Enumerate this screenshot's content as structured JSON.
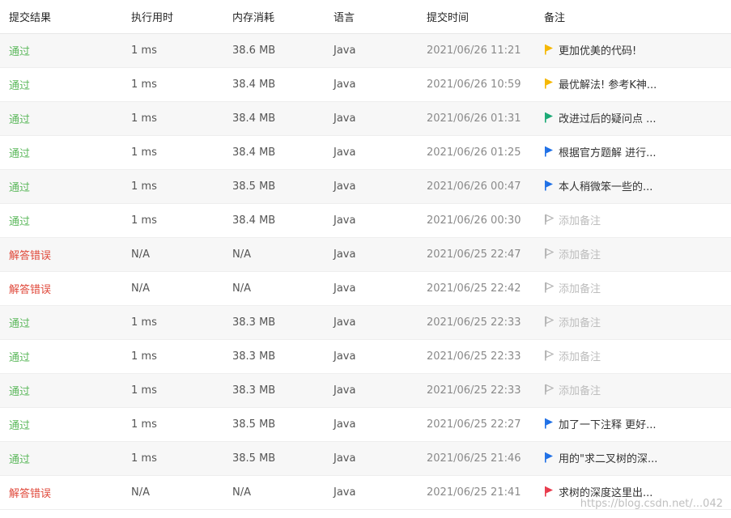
{
  "headers": {
    "status": "提交结果",
    "runtime": "执行用时",
    "memory": "内存消耗",
    "language": "语言",
    "submit_time": "提交时间",
    "note": "备注"
  },
  "colors": {
    "accepted": "#5cb85c",
    "wrong": "#e0493b",
    "flag_yellow": "#f5b700",
    "flag_green": "#19a974",
    "flag_blue": "#1e6fe6",
    "flag_red": "#e8394b",
    "flag_empty": "#b5b5b5"
  },
  "rows": [
    {
      "status": "通过",
      "type": "accepted",
      "runtime": "1 ms",
      "memory": "38.6 MB",
      "language": "Java",
      "time": "2021/06/26 11:21",
      "note": "更加优美的代码!",
      "flag": "yellow",
      "flag_icon": "flag-icon"
    },
    {
      "status": "通过",
      "type": "accepted",
      "runtime": "1 ms",
      "memory": "38.4 MB",
      "language": "Java",
      "time": "2021/06/26 10:59",
      "note": "最优解法! 参考K神...",
      "flag": "yellow",
      "flag_icon": "flag-icon"
    },
    {
      "status": "通过",
      "type": "accepted",
      "runtime": "1 ms",
      "memory": "38.4 MB",
      "language": "Java",
      "time": "2021/06/26 01:31",
      "note": "改进过后的疑问点 ...",
      "flag": "green",
      "flag_icon": "flag-icon"
    },
    {
      "status": "通过",
      "type": "accepted",
      "runtime": "1 ms",
      "memory": "38.4 MB",
      "language": "Java",
      "time": "2021/06/26 01:25",
      "note": "根据官方题解 进行...",
      "flag": "blue",
      "flag_icon": "flag-icon"
    },
    {
      "status": "通过",
      "type": "accepted",
      "runtime": "1 ms",
      "memory": "38.5 MB",
      "language": "Java",
      "time": "2021/06/26 00:47",
      "note": "本人稍微笨一些的...",
      "flag": "blue",
      "flag_icon": "flag-icon"
    },
    {
      "status": "通过",
      "type": "accepted",
      "runtime": "1 ms",
      "memory": "38.4 MB",
      "language": "Java",
      "time": "2021/06/26 00:30",
      "note": "添加备注",
      "flag": "empty",
      "flag_icon": "flag-outline-icon"
    },
    {
      "status": "解答错误",
      "type": "wrong",
      "runtime": "N/A",
      "memory": "N/A",
      "language": "Java",
      "time": "2021/06/25 22:47",
      "note": "添加备注",
      "flag": "empty",
      "flag_icon": "flag-outline-icon"
    },
    {
      "status": "解答错误",
      "type": "wrong",
      "runtime": "N/A",
      "memory": "N/A",
      "language": "Java",
      "time": "2021/06/25 22:42",
      "note": "添加备注",
      "flag": "empty",
      "flag_icon": "flag-outline-icon"
    },
    {
      "status": "通过",
      "type": "accepted",
      "runtime": "1 ms",
      "memory": "38.3 MB",
      "language": "Java",
      "time": "2021/06/25 22:33",
      "note": "添加备注",
      "flag": "empty",
      "flag_icon": "flag-outline-icon"
    },
    {
      "status": "通过",
      "type": "accepted",
      "runtime": "1 ms",
      "memory": "38.3 MB",
      "language": "Java",
      "time": "2021/06/25 22:33",
      "note": "添加备注",
      "flag": "empty",
      "flag_icon": "flag-outline-icon"
    },
    {
      "status": "通过",
      "type": "accepted",
      "runtime": "1 ms",
      "memory": "38.3 MB",
      "language": "Java",
      "time": "2021/06/25 22:33",
      "note": "添加备注",
      "flag": "empty",
      "flag_icon": "flag-outline-icon"
    },
    {
      "status": "通过",
      "type": "accepted",
      "runtime": "1 ms",
      "memory": "38.5 MB",
      "language": "Java",
      "time": "2021/06/25 22:27",
      "note": "加了一下注释 更好...",
      "flag": "blue",
      "flag_icon": "flag-icon"
    },
    {
      "status": "通过",
      "type": "accepted",
      "runtime": "1 ms",
      "memory": "38.5 MB",
      "language": "Java",
      "time": "2021/06/25 21:46",
      "note": "用的\"求二叉树的深...",
      "flag": "blue",
      "flag_icon": "flag-icon"
    },
    {
      "status": "解答错误",
      "type": "wrong",
      "runtime": "N/A",
      "memory": "N/A",
      "language": "Java",
      "time": "2021/06/25 21:41",
      "note": "求树的深度这里出...",
      "flag": "red",
      "flag_icon": "flag-icon"
    }
  ],
  "watermark": "https://blog.csdn.net/...042"
}
